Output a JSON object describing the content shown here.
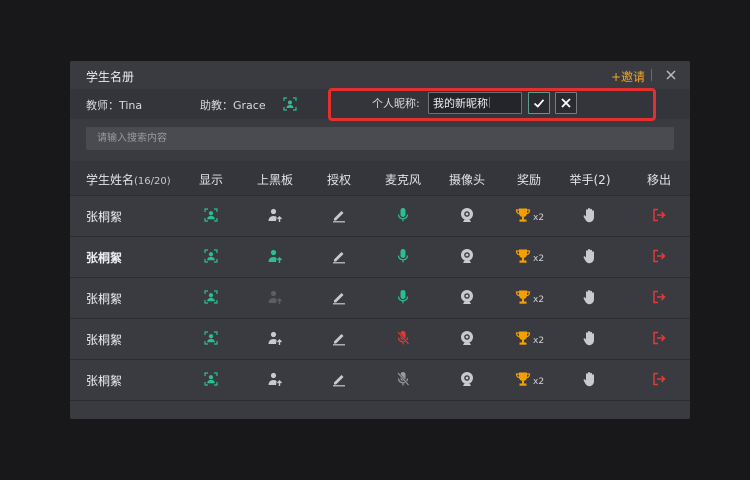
{
  "dialog": {
    "title": "学生名册",
    "invite_label": "+邀请"
  },
  "info": {
    "teacher_label": "教师：Tina",
    "assistant_label": "助教：Grace",
    "nickname_label": "个人昵称:",
    "nickname_value": "我的新昵称"
  },
  "search": {
    "placeholder": "请输入搜索内容"
  },
  "table": {
    "headers": {
      "name": "学生姓名",
      "count": "(16/20)",
      "display": "显示",
      "blackboard": "上黑板",
      "authorize": "授权",
      "microphone": "麦克风",
      "camera": "摄像头",
      "reward": "奖励",
      "raise_hand": "举手(2)",
      "remove": "移出"
    },
    "rows": [
      {
        "name": "张桐絮",
        "award": "x2",
        "mic_state": "on",
        "blackboard_state": "normal"
      },
      {
        "name": "张桐絮",
        "award": "x2",
        "mic_state": "on",
        "blackboard_state": "active"
      },
      {
        "name": "张桐絮",
        "award": "x2",
        "mic_state": "on",
        "blackboard_state": "disabled"
      },
      {
        "name": "张桐絮",
        "award": "x2",
        "mic_state": "muted",
        "blackboard_state": "normal"
      },
      {
        "name": "张桐絮",
        "award": "x2",
        "mic_state": "off",
        "blackboard_state": "normal"
      }
    ]
  },
  "colors": {
    "accent_green": "#2bbf8f",
    "invite_orange": "#f5a623",
    "danger_red": "#e53935",
    "trophy_gold": "#f5a000"
  },
  "icons": {
    "display": "person-frame-icon",
    "blackboard": "person-upload-icon",
    "authorize": "pencil-icon",
    "microphone": "microphone-icon",
    "camera": "webcam-icon",
    "reward": "trophy-icon",
    "raise_hand": "hand-icon",
    "remove": "exit-icon"
  }
}
